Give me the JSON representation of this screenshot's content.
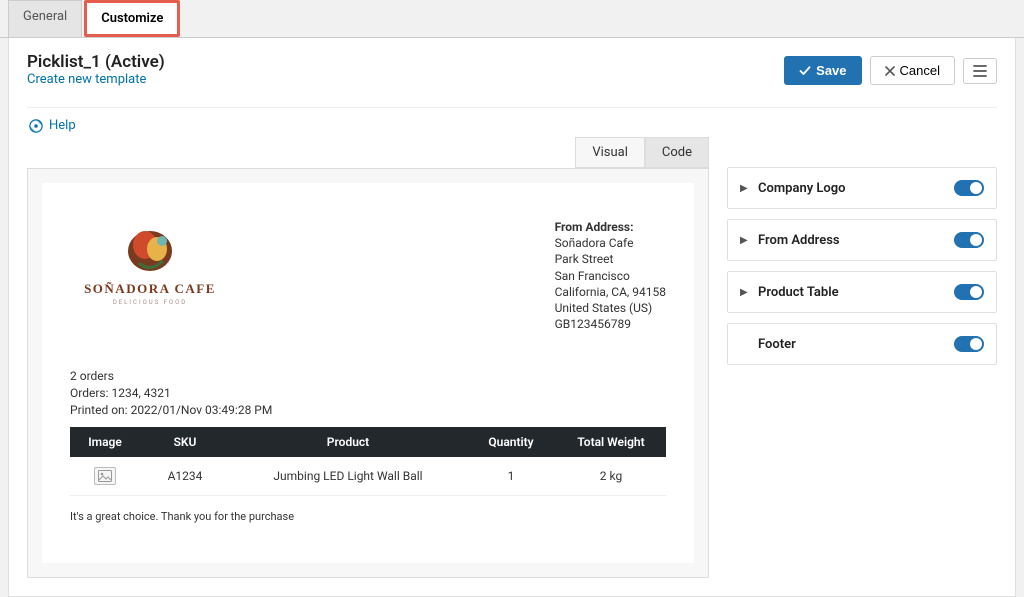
{
  "tabs": {
    "general": "General",
    "customize": "Customize"
  },
  "header": {
    "title": "Picklist_1 (Active)",
    "new_template_link": "Create new template",
    "save_label": "Save",
    "cancel_label": "Cancel"
  },
  "help_label": "Help",
  "preview_tabs": {
    "visual": "Visual",
    "code": "Code"
  },
  "logo": {
    "name": "SOÑADORA CAFE",
    "sub": "DELICIOUS FOOD"
  },
  "from": {
    "label": "From Address:",
    "line1": "Soñadora Cafe",
    "line2": "Park Street",
    "line3": "San Francisco",
    "line4": "California, CA, 94158",
    "line5": "United States (US)",
    "line6": "GB123456789"
  },
  "orders_block": {
    "count": "2 orders",
    "orders": "Orders: 1234, 4321",
    "printed": "Printed on: 2022/01/Nov 03:49:28 PM"
  },
  "table": {
    "headers": {
      "image": "Image",
      "sku": "SKU",
      "product": "Product",
      "qty": "Quantity",
      "weight": "Total Weight"
    },
    "rows": [
      {
        "sku": "A1234",
        "product": "Jumbing LED Light Wall Ball",
        "qty": "1",
        "weight": "2 kg"
      }
    ]
  },
  "footer_note": "It's a great choice. Thank you for the purchase",
  "side_panels": [
    {
      "label": "Company Logo",
      "expandable": true
    },
    {
      "label": "From Address",
      "expandable": true
    },
    {
      "label": "Product Table",
      "expandable": true
    },
    {
      "label": "Footer",
      "expandable": false
    }
  ]
}
